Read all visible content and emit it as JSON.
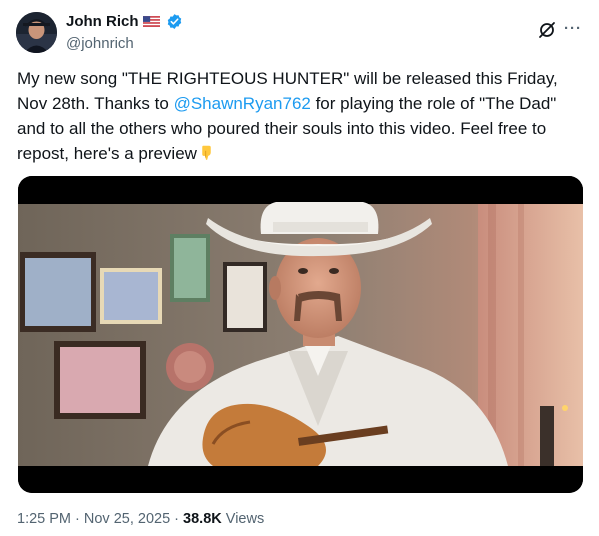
{
  "author": {
    "name": "John Rich",
    "handle": "@johnrich",
    "flag_icon": "us-flag-icon",
    "verified_icon": "verified-badge-icon"
  },
  "header_actions": {
    "grok_icon": "grok-icon",
    "more_label": "···"
  },
  "tweet": {
    "text_part1": "My new song \"THE RIGHTEOUS HUNTER\" will be released this Friday, Nov 28th. Thanks to ",
    "mention": "@ShawnRyan762",
    "text_part2": " for playing the role of \"The Dad\" and to all the others who poured their souls into this video. Feel free to repost, here's a preview",
    "emoji": "pointing-down-emoji"
  },
  "meta": {
    "time": "1:25 PM",
    "sep1": " · ",
    "date": "Nov 25, 2025",
    "sep2": " · ",
    "views_count": "38.8K",
    "views_label": " Views"
  },
  "colors": {
    "accent": "#1d9bf0",
    "text": "#0f1419",
    "muted": "#536471"
  }
}
